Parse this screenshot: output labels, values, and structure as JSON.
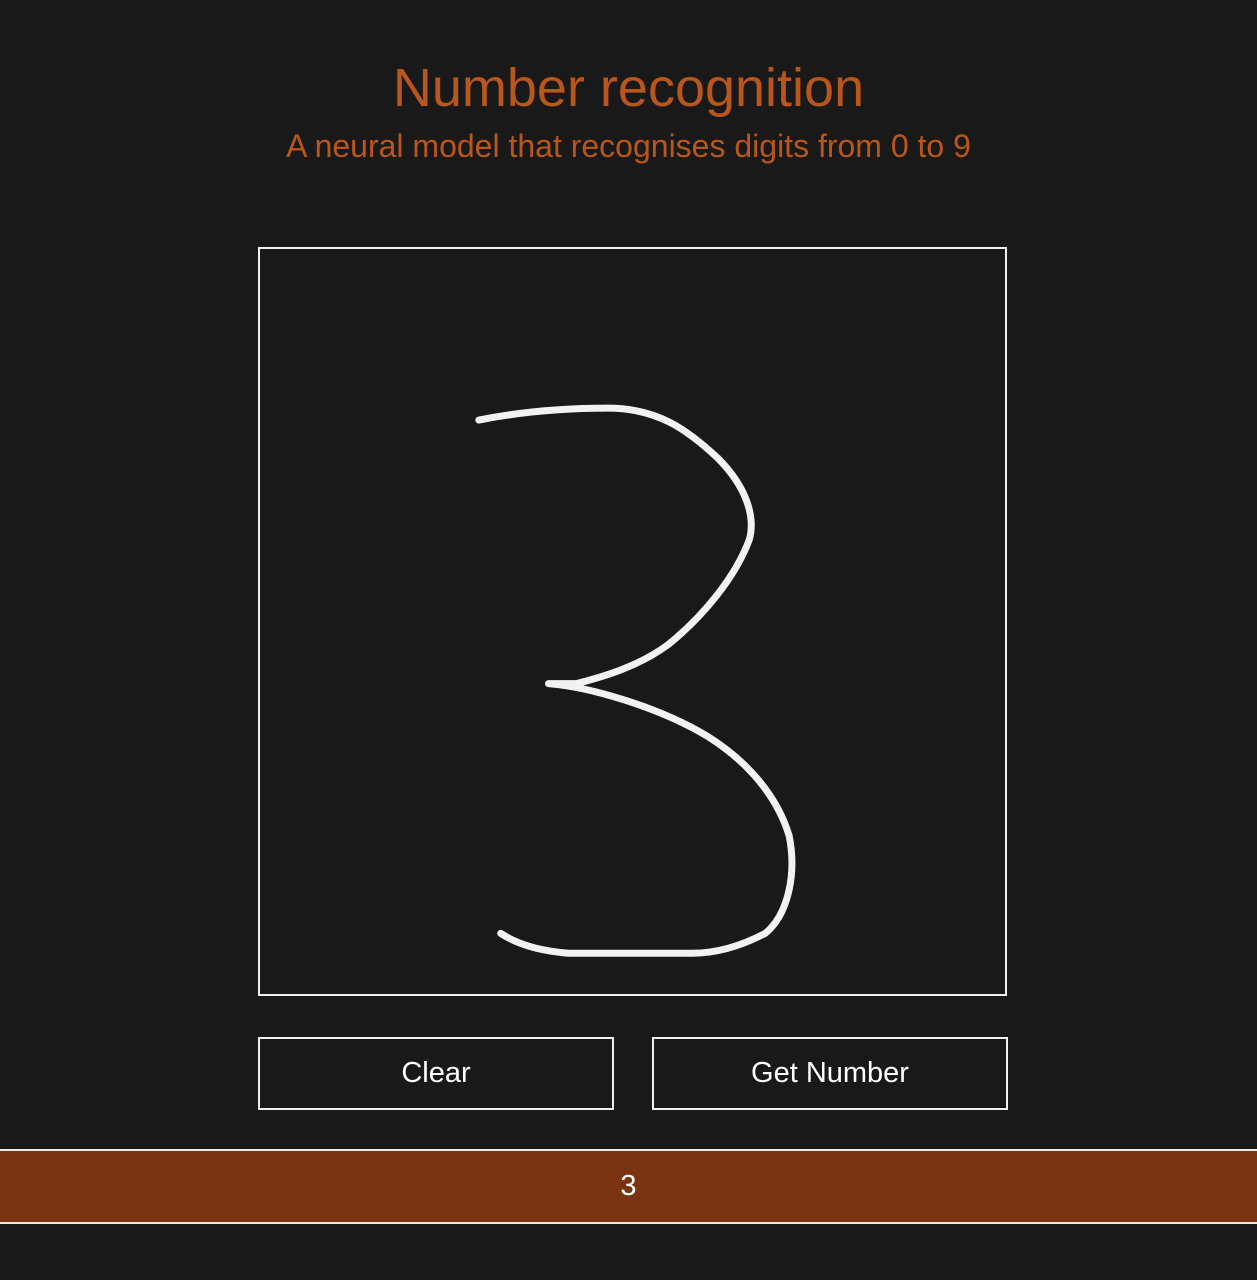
{
  "header": {
    "title": "Number recognition",
    "subtitle": "A neural model that recognises digits from 0 to 9"
  },
  "canvas": {
    "stroke_color": "#f2f2f2",
    "background_color": "#191919"
  },
  "controls": {
    "clear_label": "Clear",
    "get_number_label": "Get Number"
  },
  "result": {
    "value": "3"
  },
  "colors": {
    "accent": "#b9561c",
    "result_bar": "#7a3412",
    "background": "#191919",
    "border": "#f0f0f0"
  }
}
